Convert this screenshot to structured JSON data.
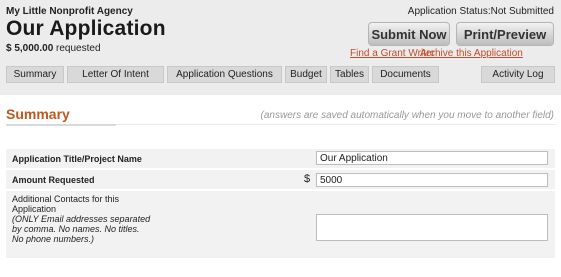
{
  "header": {
    "org_name": "My Little Nonprofit Agency",
    "app_title": "Our Application",
    "amount": "$ 5,000.00",
    "amount_suffix": " requested",
    "status": "Application Status:Not Submitted",
    "submit_label": "Submit Now",
    "print_label": "Print/Preview",
    "grant_writer_link": "Find a Grant Writer",
    "archive_link": "Archive this Application"
  },
  "tabs": [
    {
      "label": "Summary"
    },
    {
      "label": "Letter Of Intent"
    },
    {
      "label": "Application Questions"
    },
    {
      "label": "Budget"
    },
    {
      "label": "Tables"
    },
    {
      "label": "Documents"
    },
    {
      "label": "Activity Log"
    }
  ],
  "section": {
    "title": "Summary",
    "autosave_note": "(answers are saved automatically when you move to another field)"
  },
  "form": {
    "title_label": "Application Title/Project Name",
    "title_value": "Our Application",
    "amount_label": "Amount Requested",
    "currency_symbol": "$",
    "amount_value": "5000",
    "contacts_label_line1": "Additional Contacts for this",
    "contacts_label_line2": "Application",
    "contacts_note_line1": "(ONLY Email addresses separated",
    "contacts_note_line2": "by comma. No names. No titles.",
    "contacts_note_line3": "No phone numbers.)",
    "contacts_value": ""
  }
}
